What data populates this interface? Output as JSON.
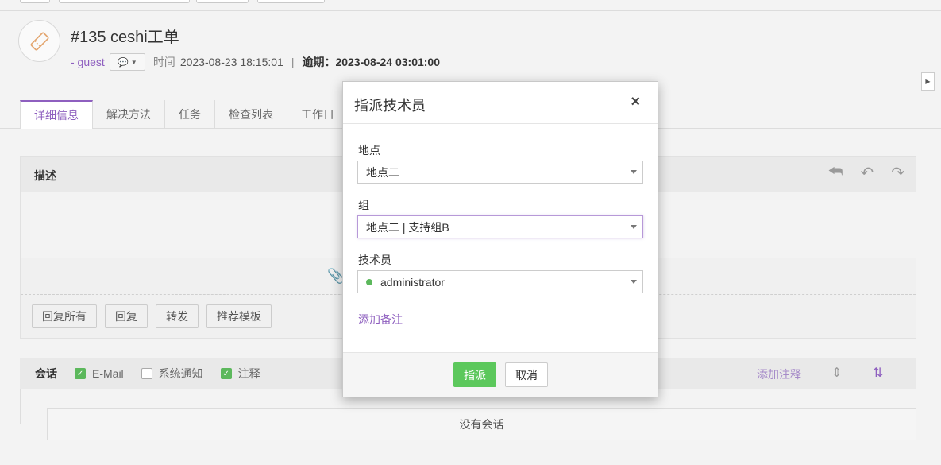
{
  "ticket": {
    "title": "#135  ceshi工单",
    "user": "- guest",
    "time_label": "时间",
    "time_value": "2023-08-23 18:15:01",
    "separator": "|",
    "due_text": "逾期：2023-08-24 03:01:00"
  },
  "tabs": [
    {
      "label": "详细信息",
      "active": true
    },
    {
      "label": "解决方法",
      "active": false
    },
    {
      "label": "任务",
      "active": false
    },
    {
      "label": "检查列表",
      "active": false
    },
    {
      "label": "工作日",
      "active": false
    }
  ],
  "description": {
    "label": "描述"
  },
  "reply_buttons": [
    "回复所有",
    "回复",
    "转发",
    "推荐模板"
  ],
  "conversation": {
    "label": "会话",
    "filters": [
      {
        "label": "E-Mail",
        "checked": true
      },
      {
        "label": "系统通知",
        "checked": false
      },
      {
        "label": "注释",
        "checked": true
      }
    ],
    "add_note": "添加注释",
    "empty_text": "没有会话"
  },
  "modal": {
    "title": "指派技术员",
    "close_glyph": "×",
    "location_label": "地点",
    "location_value": "地点二",
    "group_label": "组",
    "group_value": "地点二 | 支持组B",
    "technician_label": "技术员",
    "technician_value": "administrator",
    "add_note": "添加备注",
    "assign_button": "指派",
    "cancel_button": "取消"
  },
  "colors": {
    "accent": "#8e5fbf",
    "success": "#5cc85c"
  }
}
